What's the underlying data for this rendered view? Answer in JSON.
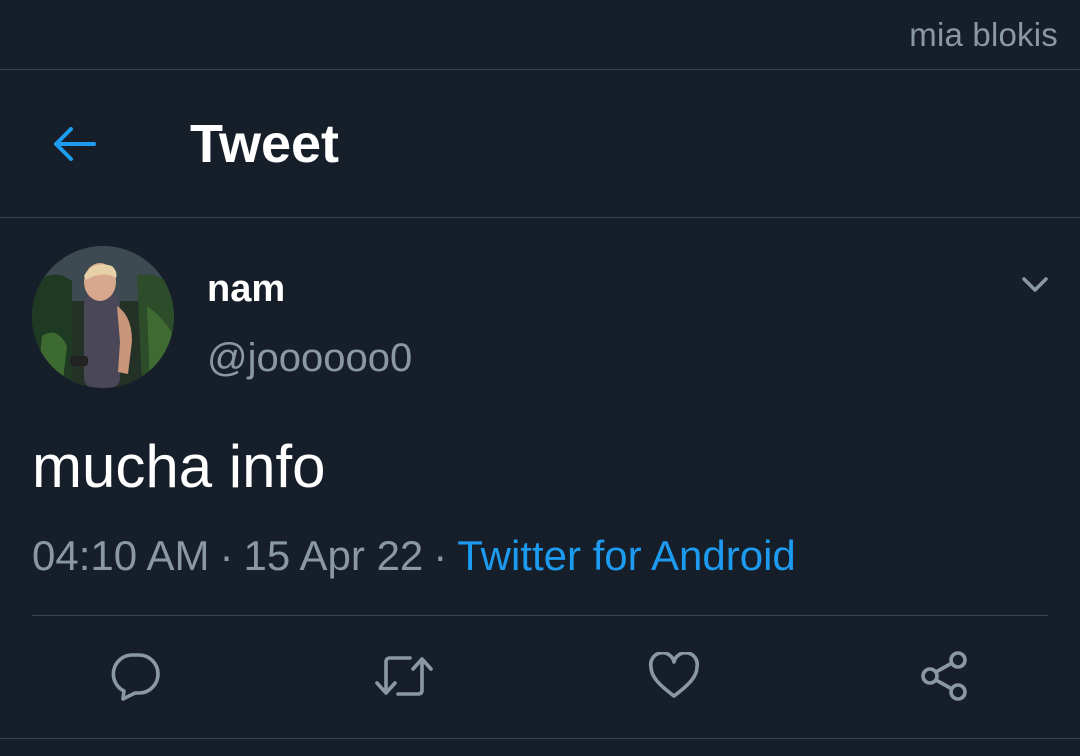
{
  "watermark": "mia blokis",
  "header": {
    "title": "Tweet",
    "back_icon": "arrow-left-icon"
  },
  "tweet": {
    "display_name": "nam",
    "handle": "@joooooo0",
    "text": "mucha info",
    "time": "04:10 AM",
    "date": "15 Apr 22",
    "source": "Twitter for Android",
    "separator": "·",
    "menu_icon": "chevron-down-icon"
  },
  "actions": [
    {
      "name": "reply",
      "icon": "reply-icon"
    },
    {
      "name": "retweet",
      "icon": "retweet-icon"
    },
    {
      "name": "like",
      "icon": "heart-icon"
    },
    {
      "name": "share",
      "icon": "share-icon"
    }
  ],
  "colors": {
    "background": "#161f29",
    "accent": "#1d9bf0",
    "secondary_text": "#8a98a5",
    "divider": "#38444d"
  }
}
